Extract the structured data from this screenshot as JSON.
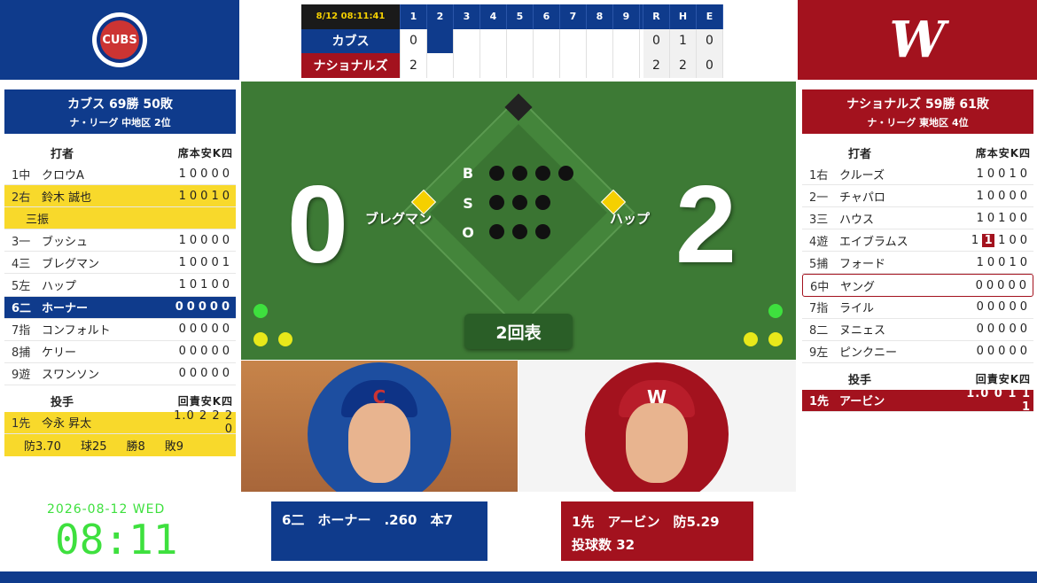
{
  "colors": {
    "away": "#0f3b8c",
    "home": "#a3121e",
    "field": "#3d7a35",
    "highlight": "#f8d92b",
    "clock": "#3ee03e"
  },
  "logos": {
    "away_text": "CUBS",
    "home_text": "W"
  },
  "scoreboard": {
    "time": "8/12 08:11:41",
    "innings": [
      "1",
      "2",
      "3",
      "4",
      "5",
      "6",
      "7",
      "8",
      "9"
    ],
    "totals_labels": [
      "R",
      "H",
      "E"
    ],
    "away": {
      "name": "カブス",
      "innings": [
        "0",
        "",
        "",
        "",
        "",
        "",
        "",
        "",
        ""
      ],
      "totals": [
        "0",
        "1",
        "0"
      ]
    },
    "home": {
      "name": "ナショナルズ",
      "innings": [
        "2",
        "",
        "",
        "",
        "",
        "",
        "",
        "",
        ""
      ],
      "totals": [
        "2",
        "2",
        "0"
      ]
    }
  },
  "away": {
    "record": "カブス 69勝 50敗",
    "league": "ナ・リーグ 中地区 2位",
    "batters_header": "打者",
    "stats_header": "席本安K四",
    "batters": [
      {
        "pos": "1中",
        "name": "クロウA",
        "stats": "10000"
      },
      {
        "pos": "2右",
        "name": "鈴木 誠也",
        "stats": "10010"
      },
      {
        "pos": "3一",
        "name": "ブッシュ",
        "stats": "10000"
      },
      {
        "pos": "4三",
        "name": "ブレグマン",
        "stats": "10001"
      },
      {
        "pos": "5左",
        "name": "ハップ",
        "stats": "10100"
      },
      {
        "pos": "6二",
        "name": "ホーナー",
        "stats": "00000"
      },
      {
        "pos": "7指",
        "name": "コンフォルト",
        "stats": "00000"
      },
      {
        "pos": "8捕",
        "name": "ケリー",
        "stats": "00000"
      },
      {
        "pos": "9遊",
        "name": "スワンソン",
        "stats": "00000"
      }
    ],
    "batter2_result": "三振",
    "pitchers_header": "投手",
    "pitcher_stats_header": "回責安K四",
    "pitcher": {
      "pos": "1先",
      "name": "今永 昇太",
      "stats": "1.0 2 2 2 0"
    },
    "pitcher_detail": [
      "防3.70",
      "球25",
      "勝8",
      "敗9"
    ]
  },
  "home": {
    "record": "ナショナルズ 59勝 61敗",
    "league": "ナ・リーグ 東地区 4位",
    "batters_header": "打者",
    "stats_header": "席本安K四",
    "batters": [
      {
        "pos": "1右",
        "name": "クルーズ",
        "stats": "10010"
      },
      {
        "pos": "2一",
        "name": "チャパロ",
        "stats": "10000"
      },
      {
        "pos": "3三",
        "name": "ハウス",
        "stats": "10100"
      },
      {
        "pos": "4遊",
        "name": "エイブラムス",
        "stats_pre": "1",
        "stats_box": "1",
        "stats_post": "100"
      },
      {
        "pos": "5捕",
        "name": "フォード",
        "stats": "10010"
      },
      {
        "pos": "6中",
        "name": "ヤング",
        "stats": "00000"
      },
      {
        "pos": "7指",
        "name": "ライル",
        "stats": "00000"
      },
      {
        "pos": "8二",
        "name": "ヌニェス",
        "stats": "00000"
      },
      {
        "pos": "9左",
        "name": "ピンクニー",
        "stats": "00000"
      }
    ],
    "pitchers_header": "投手",
    "pitcher_stats_header": "回責安K四",
    "pitcher": {
      "pos": "1先",
      "name": "アービン",
      "stats": "1.0 0 1 1 1"
    }
  },
  "field": {
    "away_score": "0",
    "home_score": "2",
    "runner_third": "ブレグマン",
    "runner_first": "ハップ",
    "bso_labels": [
      "B",
      "S",
      "O"
    ],
    "inning": "2回表",
    "balls": 0,
    "strikes": 0,
    "outs": 0
  },
  "current_batter": {
    "text": "6二　ホーナー　.260　本7"
  },
  "current_pitcher": {
    "line1": "1先　アービン　防5.29",
    "line2": "投球数 32"
  },
  "clock": {
    "date": "2026-08-12 WED",
    "time": "08:11"
  }
}
